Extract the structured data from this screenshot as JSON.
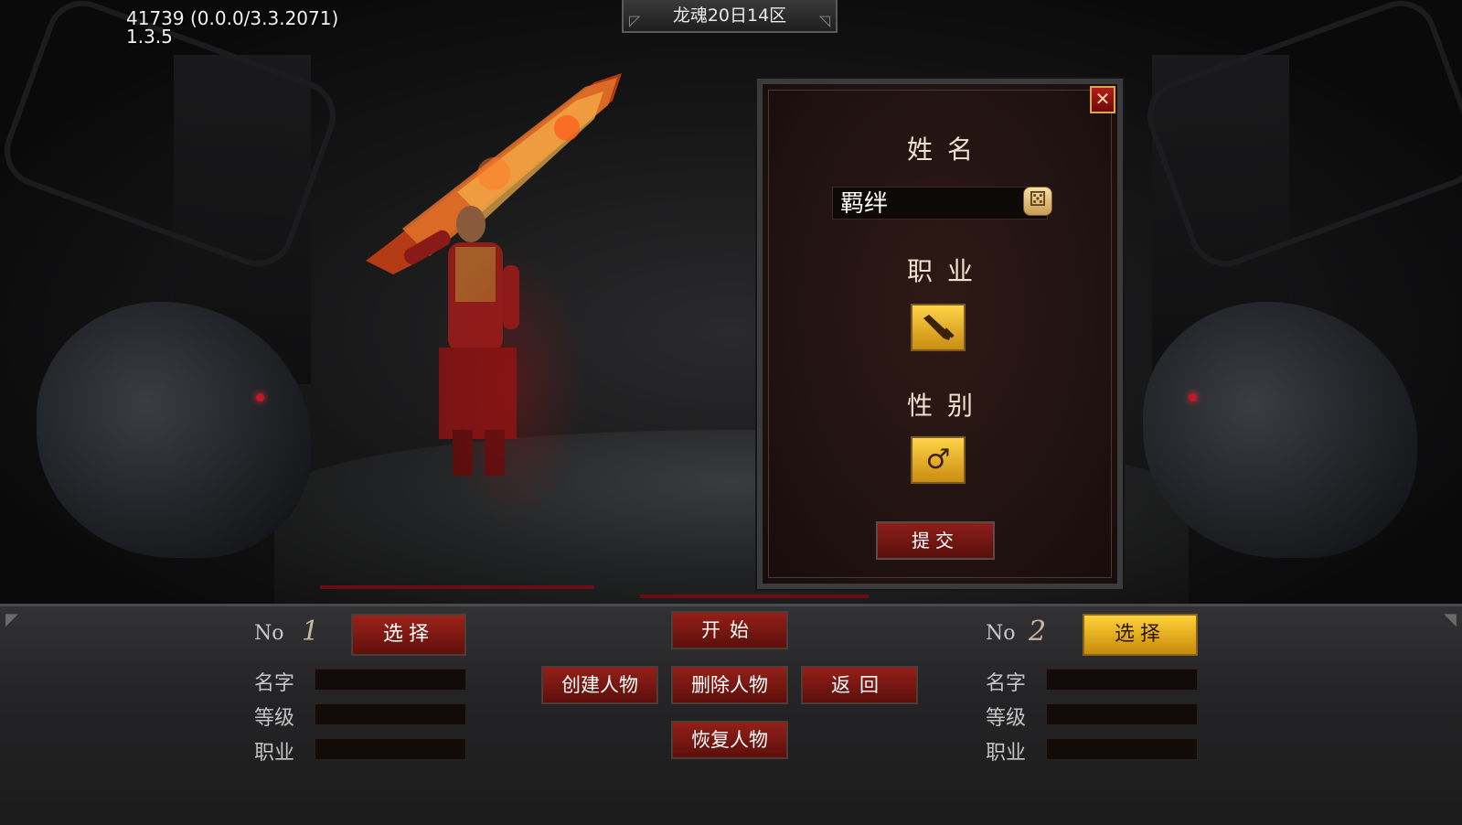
{
  "version": {
    "line1": "41739 (0.0.0/3.3.2071)",
    "line2": "1.3.5"
  },
  "server_tab": {
    "label": "龙魂20日14区"
  },
  "create_panel": {
    "close_symbol": "✕",
    "name_label": "姓名",
    "name_value": "羁绊",
    "profession_label": "职业",
    "profession_icon": "sword-icon",
    "gender_label": "性别",
    "gender_icon": "male-icon",
    "gender_symbol": "♂",
    "submit_label": "提交"
  },
  "slots": [
    {
      "no_label": "No",
      "number": "1",
      "select_label": "选择",
      "name_label": "名字",
      "level_label": "等级",
      "job_label": "职业",
      "name_value": "",
      "level_value": "",
      "job_value": ""
    },
    {
      "no_label": "No",
      "number": "2",
      "select_label": "选择",
      "name_label": "名字",
      "level_label": "等级",
      "job_label": "职业",
      "name_value": "",
      "level_value": "",
      "job_value": ""
    }
  ],
  "actions": {
    "start": "开始",
    "create": "创建人物",
    "delete": "删除人物",
    "back": "返回",
    "restore": "恢复人物"
  },
  "colors": {
    "gold_button": "#ffd23a",
    "red_button": "#9b2219",
    "panel_bg": "#211311"
  }
}
